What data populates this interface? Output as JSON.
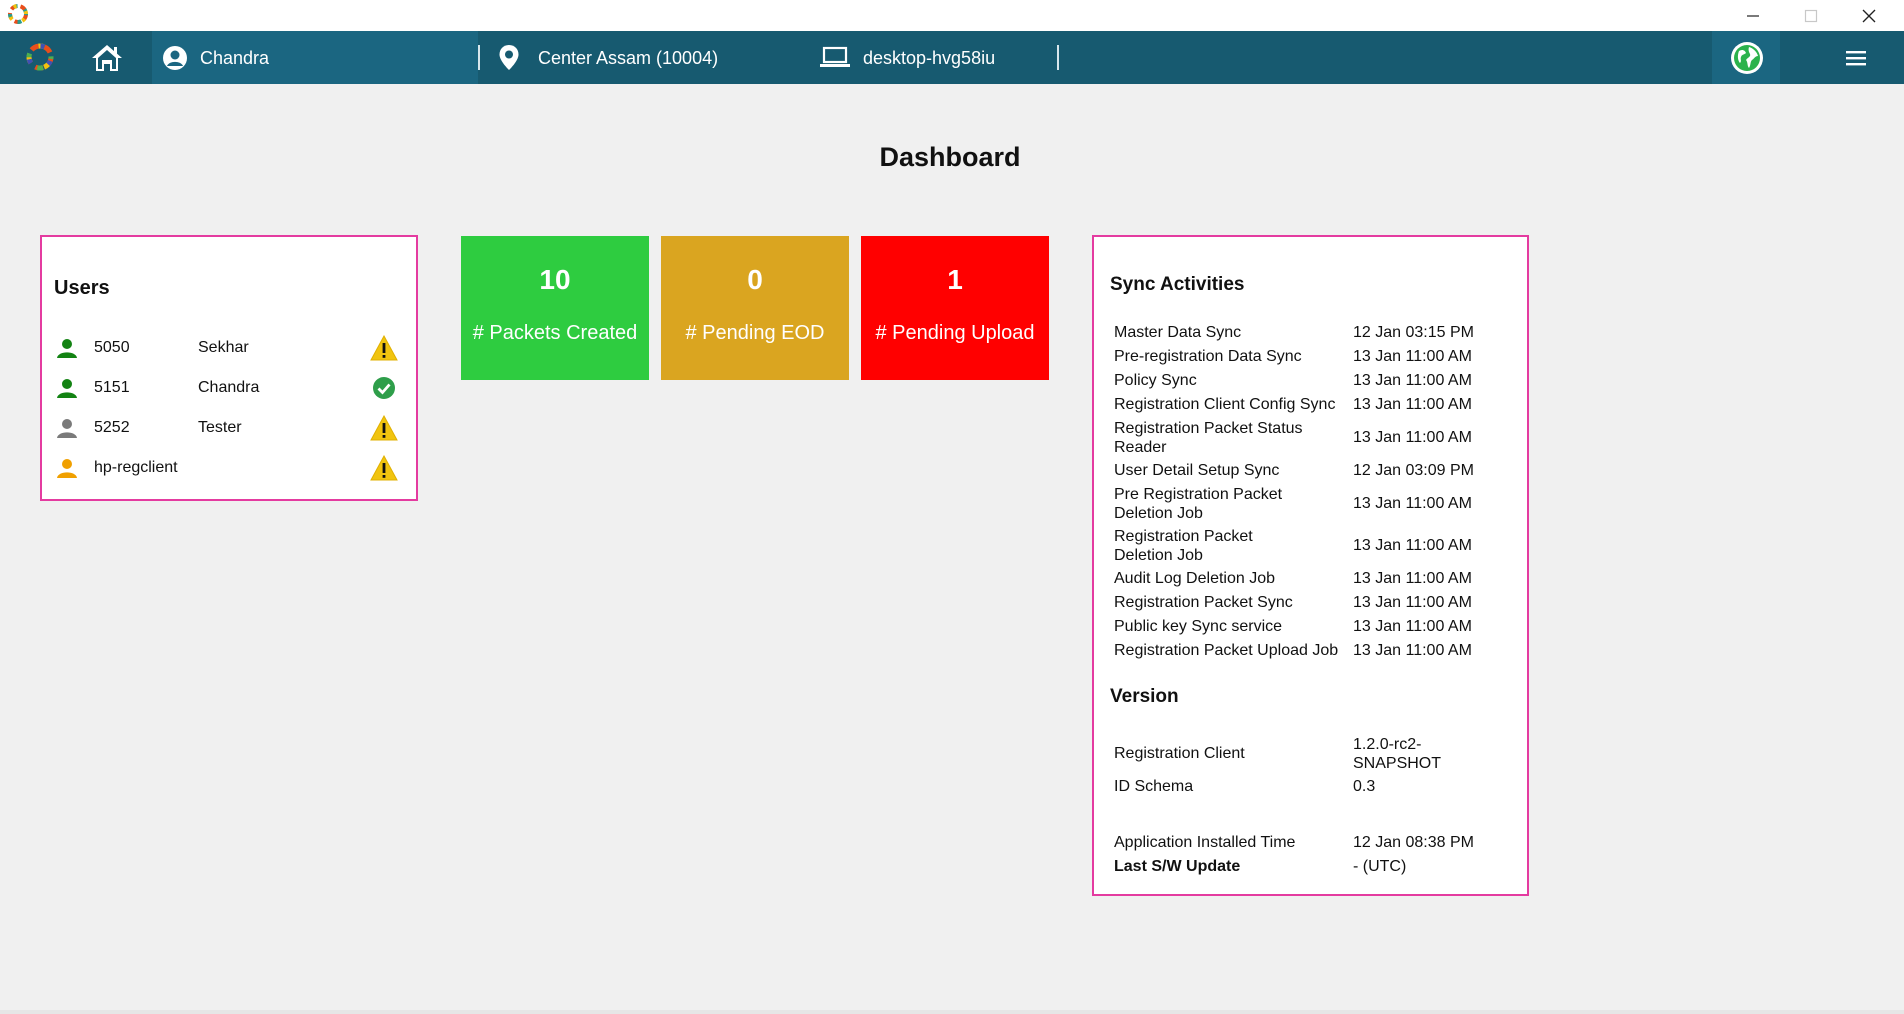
{
  "navbar": {
    "user_name": "Chandra",
    "center": "Center Assam (10004)",
    "machine": "desktop-hvg58iu"
  },
  "dashboard": {
    "title": "Dashboard"
  },
  "users_panel": {
    "title": "Users",
    "rows": [
      {
        "id": "5050",
        "name": "Sekhar",
        "icon_color": "#138313",
        "status": "warning-icon"
      },
      {
        "id": "5151",
        "name": "Chandra",
        "icon_color": "#138313",
        "status": "check-circle-icon"
      },
      {
        "id": "5252",
        "name": "Tester",
        "icon_color": "#7a7a7a",
        "status": "warning-icon"
      },
      {
        "id": "hp-regclient",
        "name": "",
        "icon_color": "#f0a000",
        "status": "warning-icon"
      }
    ]
  },
  "tiles": [
    {
      "count": "10",
      "label": "# Packets Created",
      "color": "#2ecc40"
    },
    {
      "count": "0",
      "label": "# Pending EOD",
      "color": "#daa520"
    },
    {
      "count": "1",
      "label": "# Pending Upload",
      "color": "#ff0000"
    }
  ],
  "sync_panel": {
    "title": "Sync Activities",
    "rows": [
      {
        "name": "Master Data Sync",
        "time": "12 Jan 03:15 PM"
      },
      {
        "name": "Pre-registration Data Sync",
        "time": "13 Jan 11:00 AM"
      },
      {
        "name": "Policy Sync",
        "time": "13 Jan 11:00 AM"
      },
      {
        "name": "Registration Client Config Sync",
        "time": "13 Jan 11:00 AM"
      },
      {
        "name": "Registration Packet Status Reader",
        "time": "13 Jan 11:00 AM"
      },
      {
        "name": "User Detail Setup Sync",
        "time": "12 Jan 03:09 PM"
      },
      {
        "name": "Pre Registration Packet Deletion Job",
        "time": "13 Jan 11:00 AM"
      },
      {
        "name": "Registration Packet Deletion Job",
        "time": "13 Jan 11:00 AM"
      },
      {
        "name": "Audit Log Deletion Job",
        "time": "13 Jan 11:00 AM"
      },
      {
        "name": "Registration Packet Sync",
        "time": "13 Jan 11:00 AM"
      },
      {
        "name": "Public key Sync service",
        "time": "13 Jan 11:00 AM"
      },
      {
        "name": "Registration Packet Upload Job",
        "time": "13 Jan 11:00 AM"
      }
    ],
    "version_title": "Version",
    "version_rows": [
      {
        "name": "Registration Client",
        "value": "1.2.0-rc2-SNAPSHOT"
      },
      {
        "name": "ID Schema",
        "value": "0.3"
      },
      {
        "name": "Application Installed Time",
        "value": "12 Jan 08:38 PM"
      },
      {
        "name": "Last S/W Update",
        "value": "- (UTC)"
      }
    ]
  }
}
